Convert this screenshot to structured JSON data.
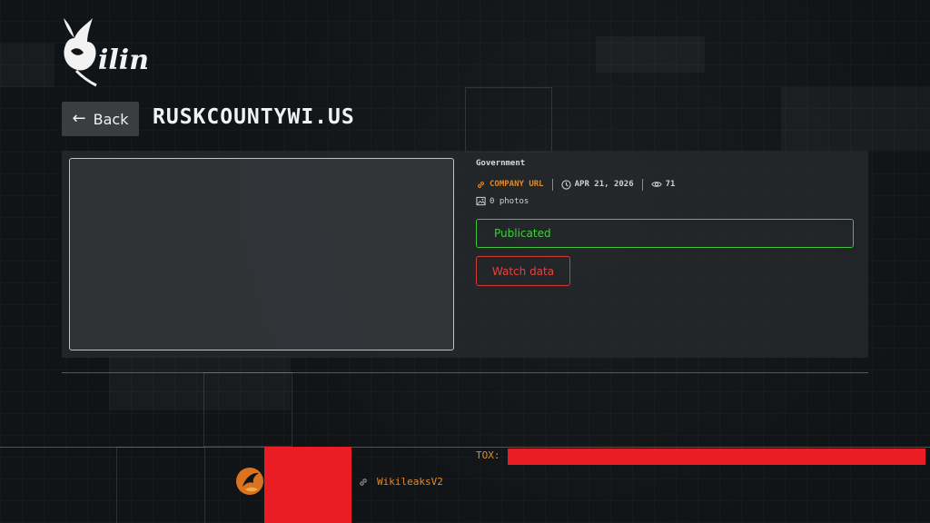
{
  "brand": {
    "logo_text": "Qilin"
  },
  "header": {
    "back_label": "Back",
    "title": "RUSKCOUNTYWI.US"
  },
  "card": {
    "category": "Government",
    "company_url_label": "COMPANY URL",
    "date": "APR 21, 2026",
    "views": "71",
    "photos": "0 photos",
    "status": "Publicated",
    "watch_label": "Watch data"
  },
  "footer": {
    "link_label": "WikileaksV2",
    "tox_label": "TOX:"
  },
  "colors": {
    "accent_orange": "#e08a2c",
    "status_green": "#3fc43a",
    "watch_red": "#d13b36",
    "redaction_red": "#ea1c24"
  },
  "icons": {
    "logo": "qilin-dragon-logo",
    "back": "arrow-left-icon",
    "link": "link-icon",
    "date": "clock-icon",
    "views": "eye-icon",
    "photos": "image-icon",
    "footer_logo": "phoenix-icon"
  }
}
